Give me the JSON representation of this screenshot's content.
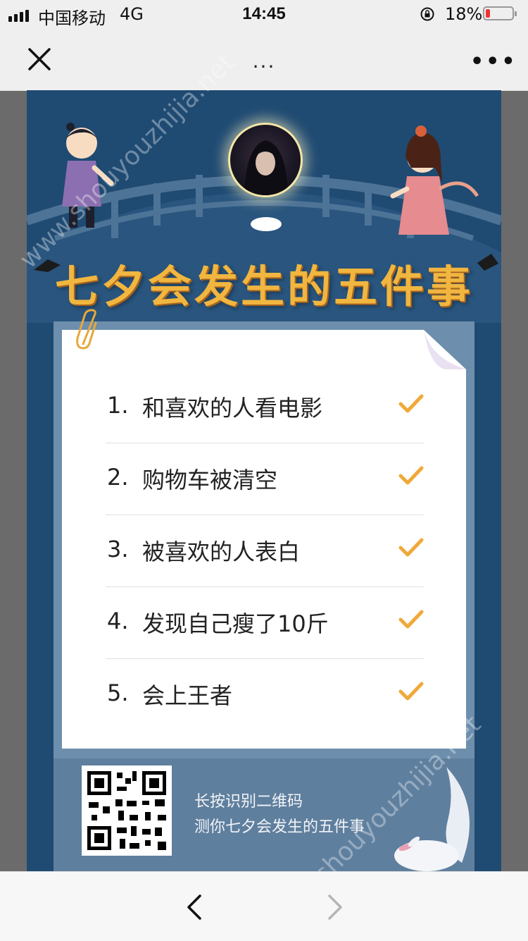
{
  "status_bar": {
    "carrier": "中国移动",
    "network": "4G",
    "time": "14:45",
    "battery_pct": "18%",
    "battery_level": 0.18
  },
  "nav": {
    "title": "...",
    "more_label": "•••"
  },
  "poster": {
    "headline": "七夕会发生的五件事",
    "items": [
      {
        "num": "1.",
        "label": "和喜欢的人看电影"
      },
      {
        "num": "2.",
        "label": "购物车被清空"
      },
      {
        "num": "3.",
        "label": "被喜欢的人表白"
      },
      {
        "num": "4.",
        "label": "发现自己瘦了10斤"
      },
      {
        "num": "5.",
        "label": "会上王者"
      }
    ],
    "qr_caption_line1": "长按识别二维码",
    "qr_caption_line2": "测你七夕会发生的五件事"
  },
  "watermark": "www.shouyouzhijia.net",
  "colors": {
    "accent_gold": "#f0b640",
    "check_orange": "#f0a93a",
    "poster_navy": "#1f4a72",
    "card_frame": "#6d8fad"
  },
  "icons": {
    "close": "close-icon",
    "back": "chevron-left-icon",
    "forward": "chevron-right-icon",
    "check": "checkmark-icon"
  }
}
